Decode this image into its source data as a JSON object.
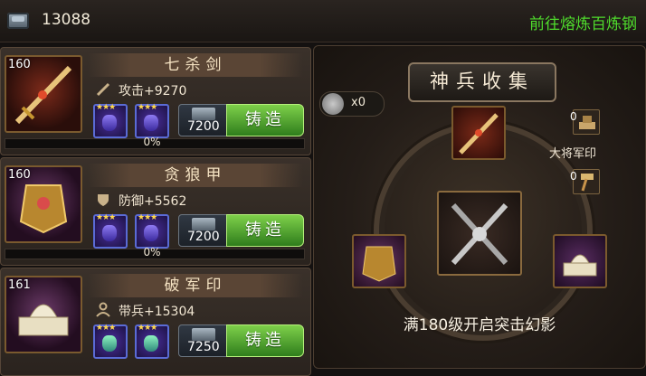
{
  "header": {
    "steel_count": "13088",
    "goto_link": "前往熔炼百炼钢"
  },
  "items": [
    {
      "level": "160",
      "name": "七杀剑",
      "stat_icon": "sword-icon",
      "stat": "攻击+9270",
      "cost": "7200",
      "forge_label": "铸造",
      "progress": 0,
      "progress_text": "0%"
    },
    {
      "level": "160",
      "name": "贪狼甲",
      "stat_icon": "shield-icon",
      "stat": "防御+5562",
      "cost": "7200",
      "forge_label": "铸造",
      "progress": 0,
      "progress_text": "0%"
    },
    {
      "level": "161",
      "name": "破军印",
      "stat_icon": "soldier-icon",
      "stat": "带兵+15304",
      "cost": "7250",
      "forge_label": "铸造",
      "progress": 0,
      "progress_text": "0%"
    }
  ],
  "collection": {
    "title": "神兵收集",
    "hammer_count": "x0",
    "seal_count": "0",
    "seal_label": "大将军印",
    "hammer2_count": "0",
    "unlock_text": "满180级开启突击幻影"
  },
  "colors": {
    "link_green": "#4fdb2c",
    "button_green": "#5dbb34",
    "gold_border": "#7a5a2e"
  }
}
